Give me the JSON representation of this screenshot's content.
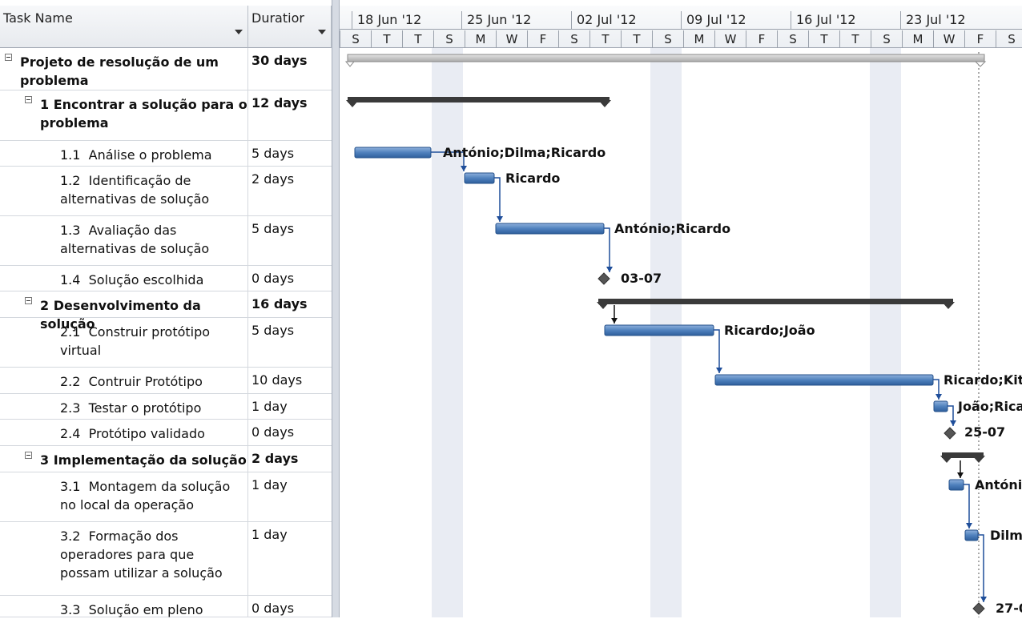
{
  "table": {
    "header_name": "Task Name",
    "header_duration": "Duratior",
    "rows": [
      {
        "name": "Projeto de resolução de um\nproblema",
        "duration": "30 days",
        "bold": true,
        "level": 0
      },
      {
        "name": "1 Encontrar a solução para o\nproblema",
        "duration": "12 days",
        "bold": true,
        "level": 1
      },
      {
        "name": "1.1  Análise o problema",
        "duration": "5 days",
        "bold": false,
        "level": 2
      },
      {
        "name": "1.2  Identificação de\nalternativas de solução",
        "duration": "2 days",
        "bold": false,
        "level": 2
      },
      {
        "name": "1.3  Avaliação das\nalternativas de solução",
        "duration": "5 days",
        "bold": false,
        "level": 2
      },
      {
        "name": "1.4  Solução escolhida",
        "duration": "0 days",
        "bold": false,
        "level": 2
      },
      {
        "name": "2 Desenvolvimento da solução",
        "duration": "16 days",
        "bold": true,
        "level": 1
      },
      {
        "name": "2.1  Construir protótipo\nvirtual",
        "duration": "5 days",
        "bold": false,
        "level": 2
      },
      {
        "name": "2.2  Contruir Protótipo",
        "duration": "10 days",
        "bold": false,
        "level": 2
      },
      {
        "name": "2.3  Testar o protótipo",
        "duration": "1 day",
        "bold": false,
        "level": 2
      },
      {
        "name": "2.4  Protótipo validado",
        "duration": "0 days",
        "bold": false,
        "level": 2
      },
      {
        "name": "3 Implementação da solução",
        "duration": "2 days",
        "bold": true,
        "level": 1
      },
      {
        "name": "3.1  Montagem da solução\nno local da operação",
        "duration": "1 day",
        "bold": false,
        "level": 2
      },
      {
        "name": "3.2  Formação dos\noperadores para que\npossam utilizar a solução",
        "duration": "1 day",
        "bold": false,
        "level": 2
      },
      {
        "name": "3.3  Solução em pleno",
        "duration": "0 days",
        "bold": false,
        "level": 2
      }
    ]
  },
  "timescale": {
    "weeks": [
      "18 Jun '12",
      "25 Jun '12",
      "02 Jul '12",
      "09 Jul '12",
      "16 Jul '12",
      "23 Jul '12"
    ],
    "days": [
      "S",
      "T",
      "T",
      "S",
      "M",
      "W",
      "F",
      "S",
      "T",
      "T",
      "S",
      "M",
      "W",
      "F",
      "S",
      "T",
      "T",
      "S",
      "M",
      "W",
      "F",
      "S"
    ]
  },
  "gantt_labels": {
    "r2": "António;Dilma;Ricardo",
    "r3": "Ricardo",
    "r4": "António;Ricardo",
    "r5": "03-07",
    "r7": "Ricardo;João",
    "r8": "Ricardo;Kit",
    "r9": "João;Ricar",
    "r10": "25-07",
    "r12": "Antónic",
    "r13": "Dilma",
    "r14": "27-0"
  },
  "colors": {
    "task_bar": "#4f81bd",
    "summary_bar": "#303030",
    "project_bar": "#b8b8b8",
    "link": "#1f4e9a"
  }
}
